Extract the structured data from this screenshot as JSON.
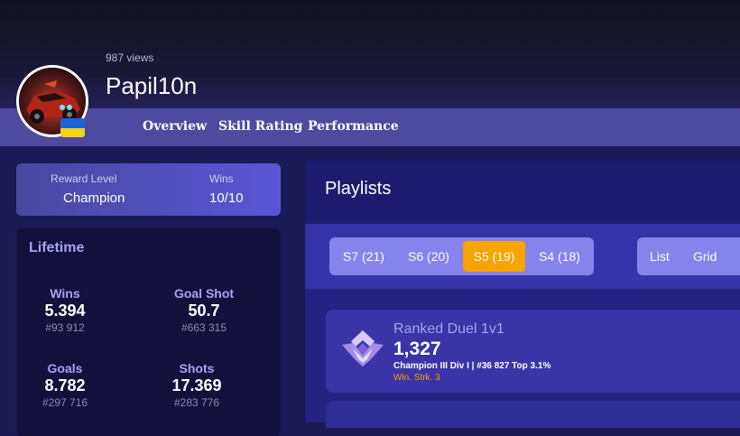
{
  "profile": {
    "views": "987 views",
    "username": "Papil10n"
  },
  "nav": {
    "items": [
      {
        "label": "Overview"
      },
      {
        "label": "Skill Rating"
      },
      {
        "label": "Performance"
      }
    ]
  },
  "reward": {
    "level_label": "Reward Level",
    "level_value": "Champion",
    "wins_label": "Wins",
    "wins_value": "10/10"
  },
  "lifetime": {
    "title": "Lifetime",
    "stats": [
      {
        "name": "Wins",
        "value": "5.394",
        "rank": "#93 912"
      },
      {
        "name": "Goal Shot",
        "value": "50.7",
        "rank": "#663 315"
      },
      {
        "name": "Goals",
        "value": "8.782",
        "rank": "#297 716"
      },
      {
        "name": "Shots",
        "value": "17.369",
        "rank": "#283 776"
      }
    ]
  },
  "playlists": {
    "title": "Playlists",
    "seasons": [
      {
        "label": "S7 (21)",
        "active": false
      },
      {
        "label": "S6 (20)",
        "active": false
      },
      {
        "label": "S5 (19)",
        "active": true
      },
      {
        "label": "S4 (18)",
        "active": false
      }
    ],
    "views": [
      {
        "label": "List"
      },
      {
        "label": "Grid"
      }
    ],
    "items": [
      {
        "name": "Ranked Duel 1v1",
        "rating": "1,327",
        "detail": "Champion III Div I | #36 827 Top 3.1%",
        "streak": "Win. Strk. 3"
      }
    ]
  },
  "colors": {
    "accent": "#f7a300",
    "label_purple": "#a7a4ef",
    "navbar": "#4e4aa0"
  },
  "icons": [
    "car-avatar",
    "ukraine-flag-icon",
    "champion-rank-icon"
  ]
}
